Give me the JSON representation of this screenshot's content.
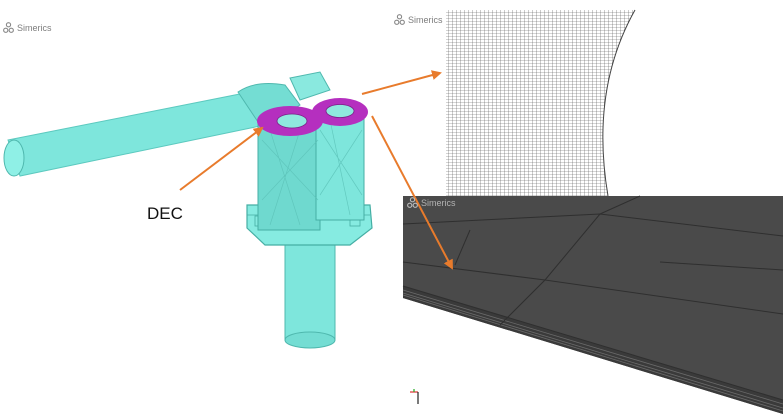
{
  "logos": {
    "main": "Simerics",
    "mesh_panel": "Simerics",
    "dark_panel": "Simerics"
  },
  "annotation": {
    "label": "DEC",
    "arrow_color": "#e87b2c"
  },
  "colors": {
    "geometry": "#7ee6dc",
    "geometry_edge": "#3fb5ab",
    "highlight_ring": "#b52fbf",
    "mesh_line": "#4a4a4a",
    "dark_mesh": "#585858",
    "background": "#ffffff"
  }
}
